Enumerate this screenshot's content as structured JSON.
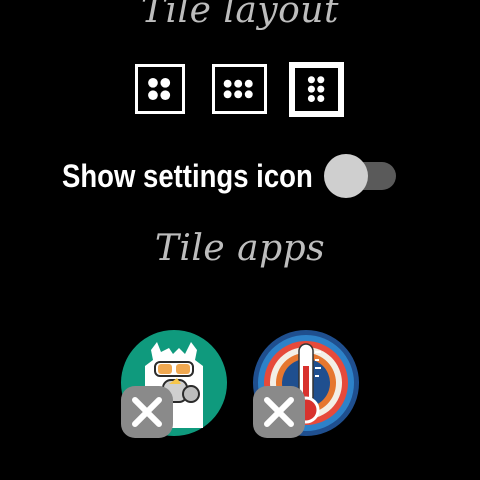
{
  "tile_layout": {
    "title": "Tile layout",
    "options": [
      {
        "name": "2x2",
        "selected": false
      },
      {
        "name": "2x3",
        "selected": false
      },
      {
        "name": "3x2",
        "selected": true
      }
    ]
  },
  "settings_toggle": {
    "label": "Show settings icon",
    "on": false
  },
  "tile_apps": {
    "title": "Tile apps",
    "apps": [
      {
        "icon": "llama-gas-mask-icon",
        "remove_icon": "close-icon"
      },
      {
        "icon": "thermometer-icon",
        "remove_icon": "close-icon"
      }
    ]
  },
  "colors": {
    "background": "#000000",
    "title": "#bdbdbd",
    "text": "#ffffff",
    "toggle_track": "#5a5a5a",
    "toggle_thumb": "#cfcfcf",
    "teal": "#0f9a7d",
    "remove_button": "#8a8a8a"
  }
}
